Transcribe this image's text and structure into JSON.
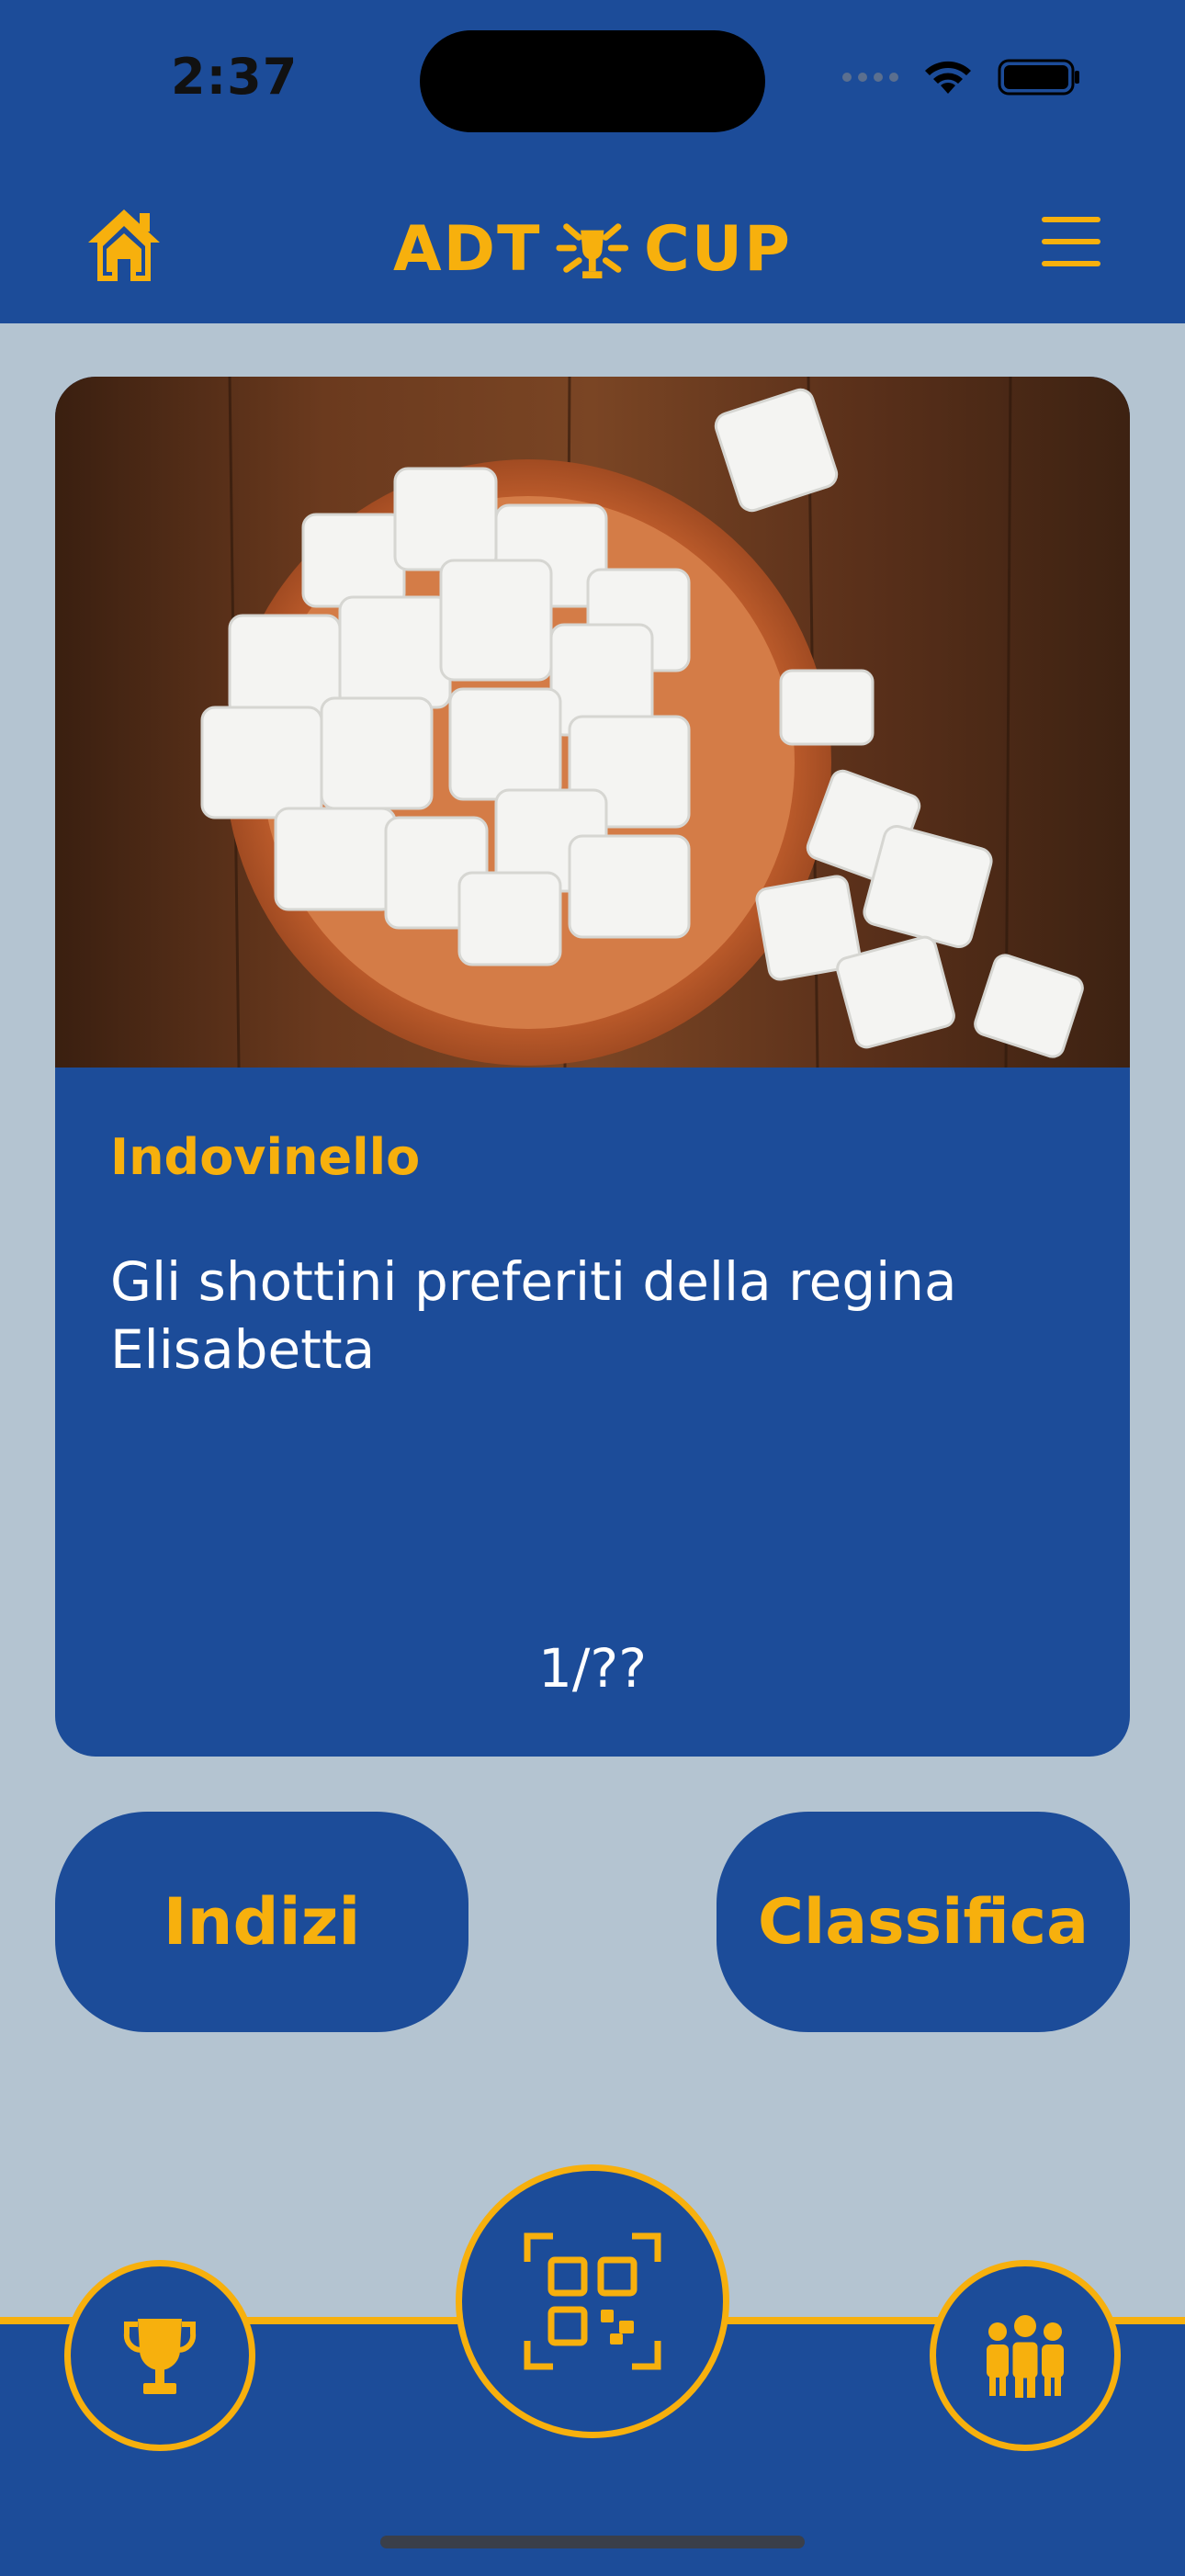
{
  "status_bar": {
    "time": "2:37"
  },
  "header": {
    "logo_left": "ADT",
    "logo_right": "CUP",
    "brand_color": "#f7b00d",
    "bg_color": "#1c4c99"
  },
  "riddle": {
    "title": "Indovinello",
    "text": "Gli shottini preferiti della regina Elisabetta",
    "counter": "1/??"
  },
  "actions": {
    "hints_label": "Indizi",
    "ranking_label": "Classifica"
  },
  "bottom_nav": {
    "icons": [
      "trophy-icon",
      "qr-scan-icon",
      "team-icon"
    ]
  }
}
